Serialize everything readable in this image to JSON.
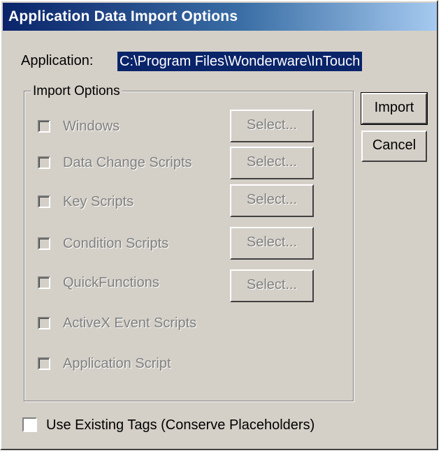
{
  "dialog": {
    "title": "Application Data Import Options",
    "application_label": "Application:",
    "application_path": "C:\\Program Files\\Wonderware\\InTouch",
    "group_title": "Import Options",
    "options": [
      {
        "label": "Windows",
        "checked": false,
        "enabled": false,
        "select_label": "Select..."
      },
      {
        "label": "Data Change Scripts",
        "checked": false,
        "enabled": false,
        "select_label": "Select..."
      },
      {
        "label": "Key Scripts",
        "checked": false,
        "enabled": false,
        "select_label": "Select..."
      },
      {
        "label": "Condition Scripts",
        "checked": false,
        "enabled": false,
        "select_label": "Select..."
      },
      {
        "label": "QuickFunctions",
        "checked": false,
        "enabled": false,
        "select_label": "Select..."
      },
      {
        "label": "ActiveX Event Scripts",
        "checked": false,
        "enabled": false
      },
      {
        "label": "Application Script",
        "checked": false,
        "enabled": false
      }
    ],
    "import_button": "Import",
    "cancel_button": "Cancel",
    "use_existing_tags": {
      "label": "Use Existing Tags (Conserve Placeholders)",
      "checked": false
    }
  }
}
